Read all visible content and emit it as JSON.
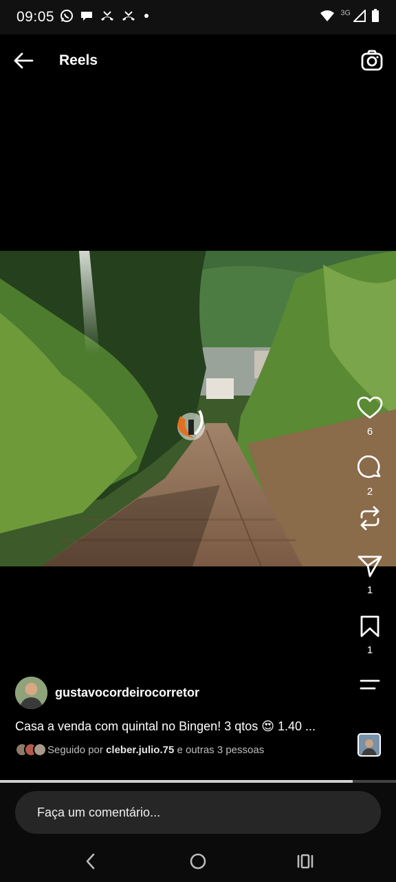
{
  "status_bar": {
    "time": "09:05",
    "network": "3G",
    "left_icons": [
      "whatsapp-icon",
      "chat-bubble-icon",
      "missed-call-icon",
      "missed-call-icon",
      "dot-icon"
    ],
    "right_icons": [
      "wifi-icon",
      "cell-signal-icon",
      "battery-icon"
    ]
  },
  "top_bar": {
    "title": "Reels",
    "back_icon": "arrow-left-icon",
    "camera_icon": "camera-icon"
  },
  "actions": {
    "like_count": "6",
    "comment_count": "2",
    "share_count": "1",
    "save_count": "1"
  },
  "post": {
    "username": "gustavocordeirocorretor",
    "caption": "Casa a venda com quintal no Bingen! 3 qtos 😍 1.40 ...",
    "followed_prefix": "Seguido por ",
    "followed_user": "cleber.julio.75",
    "followed_suffix": " e outras 3 pessoas"
  },
  "progress": {
    "fraction": 0.89
  },
  "comment": {
    "placeholder": "Faça um comentário..."
  },
  "colors": {
    "background": "#000000",
    "comment_pill": "#262626",
    "text": "#ffffff",
    "muted": "#bfbfbf"
  }
}
